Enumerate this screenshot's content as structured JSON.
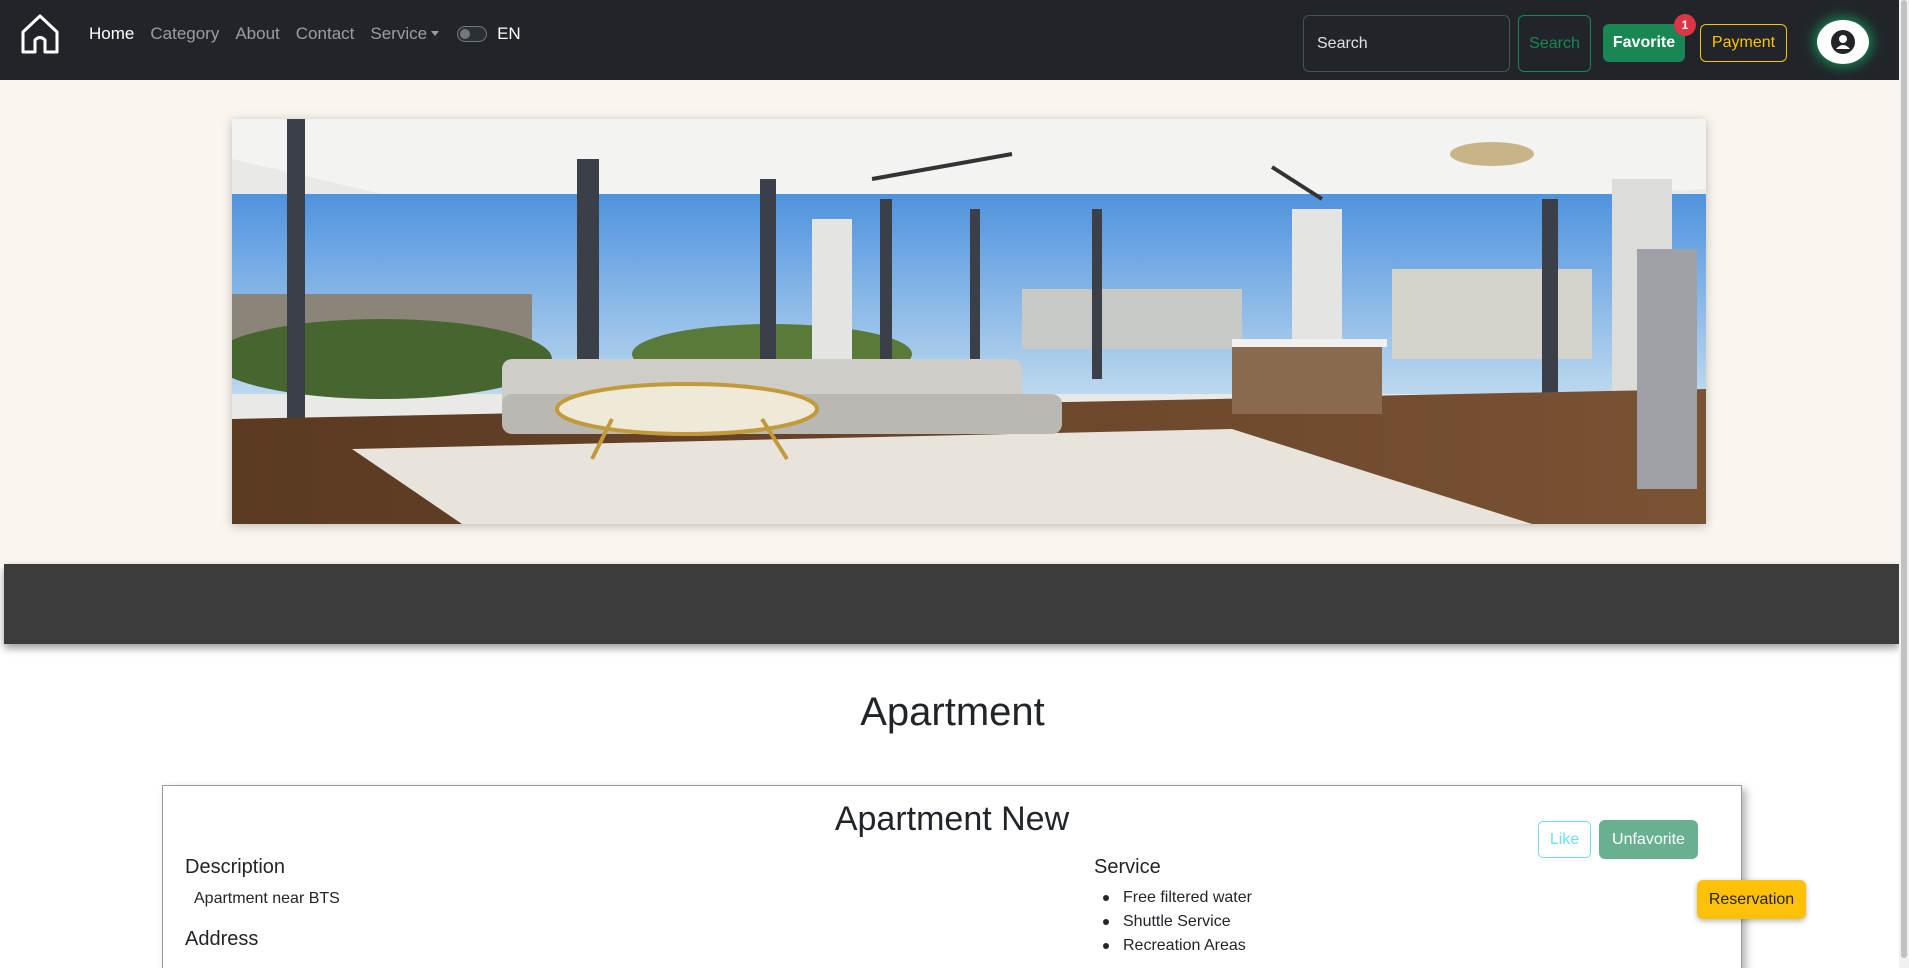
{
  "nav": {
    "links": [
      {
        "label": "Home",
        "active": true
      },
      {
        "label": "Category"
      },
      {
        "label": "About"
      },
      {
        "label": "Contact"
      },
      {
        "label": "Service"
      }
    ],
    "language": "EN",
    "search_placeholder": "Search",
    "search_button": "Search",
    "favorite_label": "Favorite",
    "favorite_count": "1",
    "payment_label": "Payment"
  },
  "hero": {
    "image_subject": "apartment-living-room"
  },
  "page": {
    "title": "Apartment"
  },
  "card": {
    "title": "Apartment New",
    "like_label": "Like",
    "unfavorite_label": "Unfavorite",
    "description_heading": "Description",
    "description_text": "Apartment near BTS",
    "address_heading": "Address",
    "service_heading": "Service",
    "services": [
      "Free filtered water",
      "Shuttle Service",
      "Recreation Areas"
    ]
  },
  "reservation_label": "Reservation",
  "colors": {
    "navbar": "#212529",
    "success": "#198754",
    "warning": "#ffc107",
    "info": "#0dcaf0",
    "danger": "#dc3545",
    "hero_bg": "#faf6ef",
    "band": "#3c3c3c"
  }
}
